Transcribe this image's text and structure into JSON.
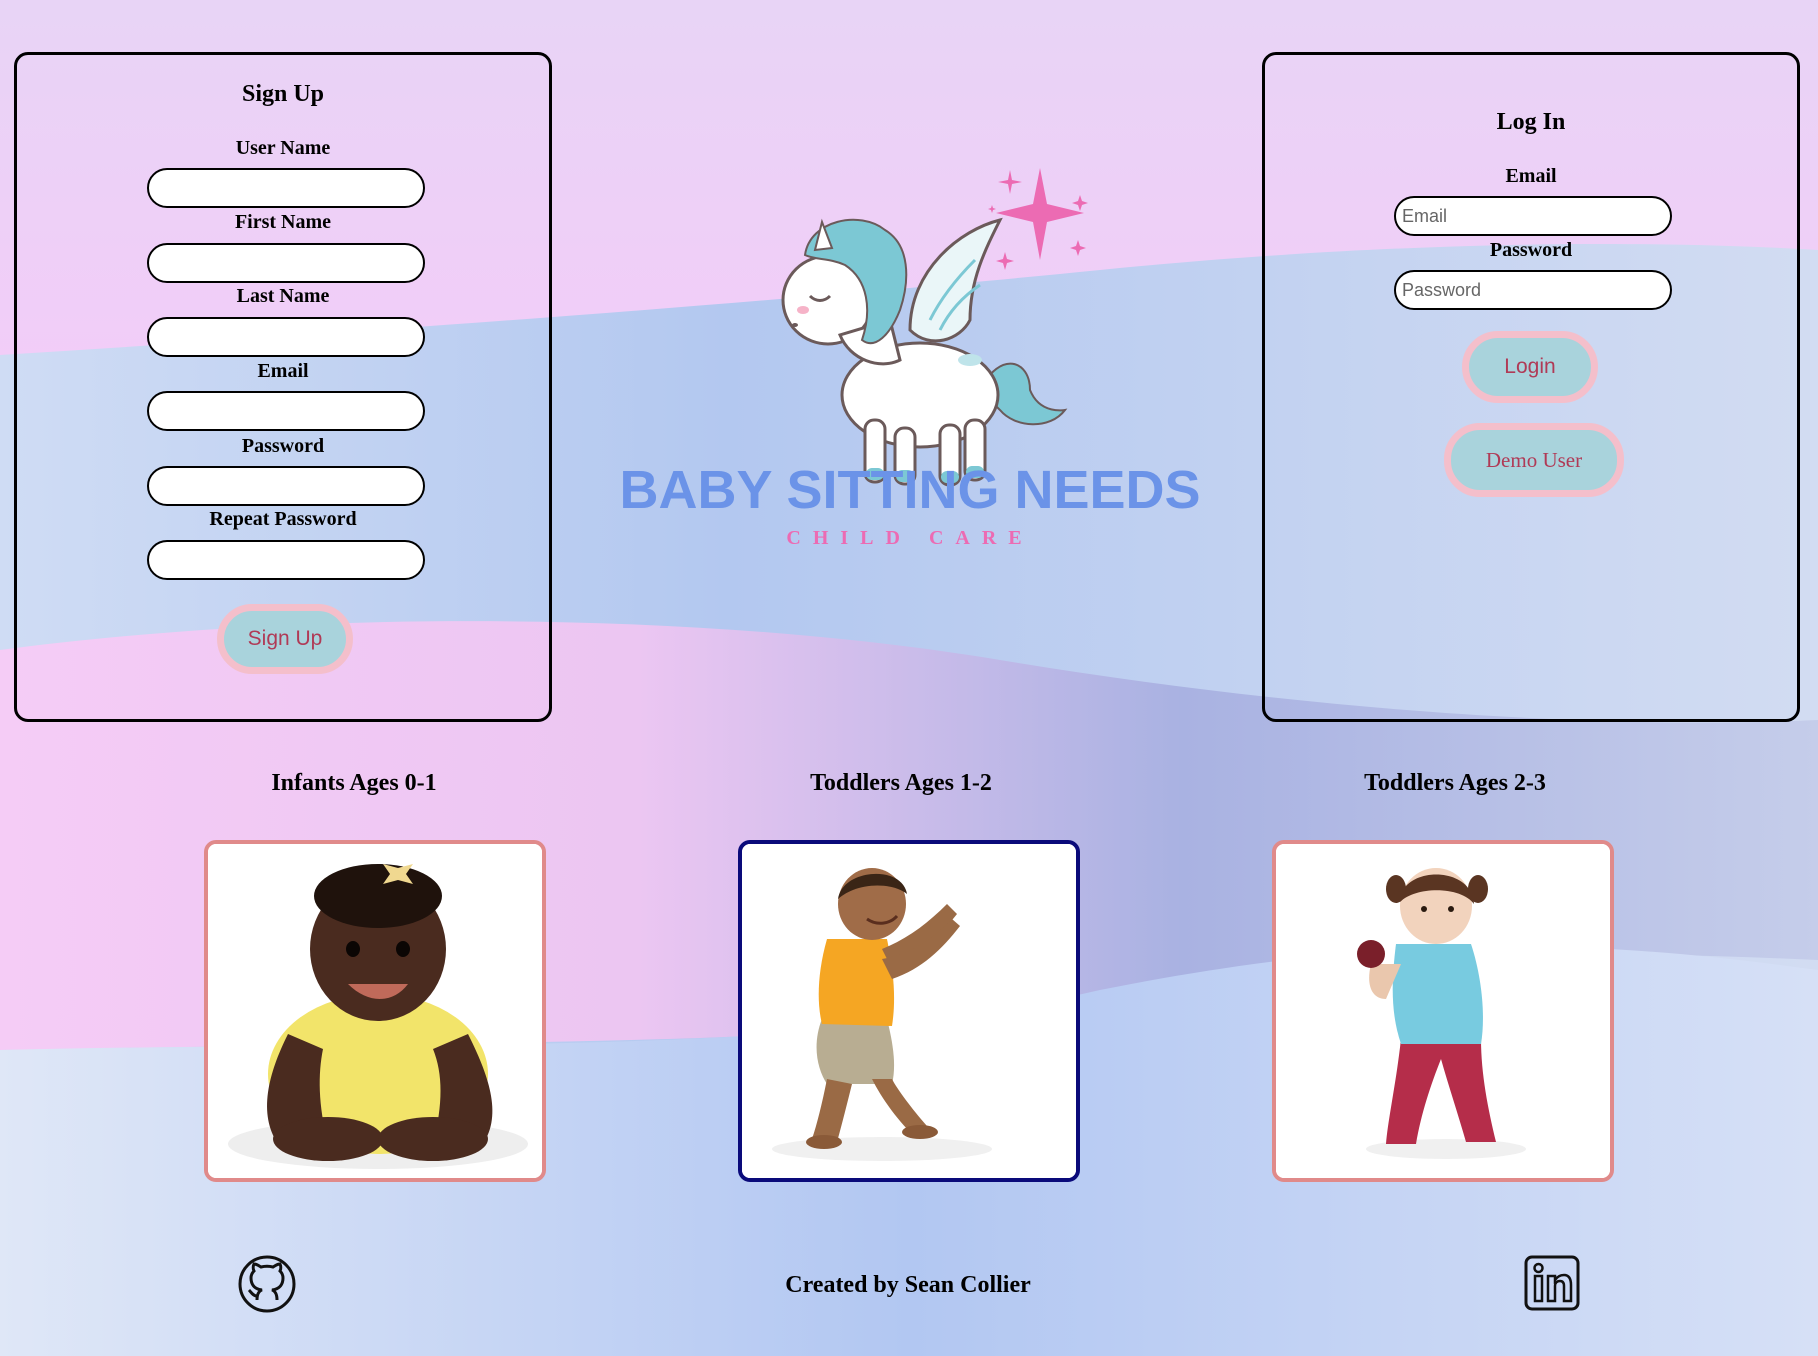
{
  "signup": {
    "title": "Sign Up",
    "fields": [
      {
        "label": "User Name",
        "value": ""
      },
      {
        "label": "First Name",
        "value": ""
      },
      {
        "label": "Last Name",
        "value": ""
      },
      {
        "label": "Email",
        "value": ""
      },
      {
        "label": "Password",
        "value": ""
      },
      {
        "label": "Repeat Password",
        "value": ""
      }
    ],
    "button_label": "Sign Up"
  },
  "login": {
    "title": "Log In",
    "email_label": "Email",
    "email_placeholder": "Email",
    "password_label": "Password",
    "password_placeholder": "Password",
    "login_button": "Login",
    "demo_button": "Demo User"
  },
  "logo": {
    "title": "BABY SITTING NEEDS",
    "subtitle": "CHILD CARE"
  },
  "age_groups": [
    {
      "title": "Infants Ages 0-1",
      "border_color": "#e08a8a"
    },
    {
      "title": "Toddlers Ages 1-2",
      "border_color": "#0a0a7a"
    },
    {
      "title": "Toddlers Ages 2-3",
      "border_color": "#e08a8a"
    }
  ],
  "footer": {
    "credit": "Created by Sean Collier",
    "github_icon": "github-icon",
    "linkedin_icon": "linkedin-icon"
  },
  "colors": {
    "button_fill": "#a9d3dc",
    "button_border": "#f4bfcb",
    "button_text": "#b03a56",
    "logo_blue": "#6b93e8",
    "logo_pink": "#ec6bb3"
  }
}
